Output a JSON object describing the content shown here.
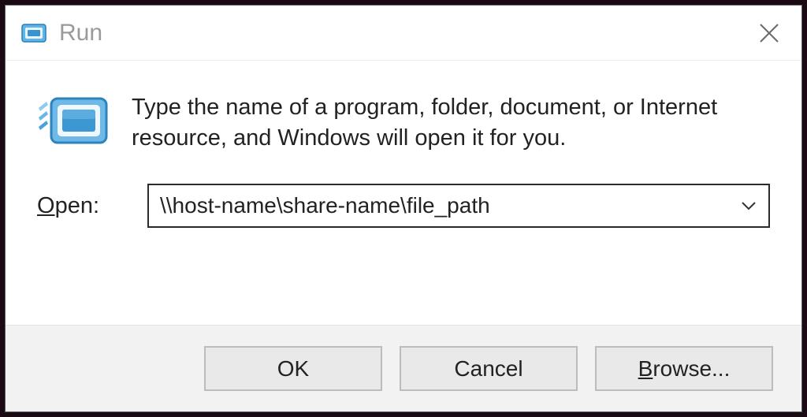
{
  "window": {
    "title": "Run"
  },
  "main": {
    "description": "Type the name of a program, folder, document, or Internet resource, and Windows will open it for you.",
    "open_label_underline": "O",
    "open_label_rest": "pen:",
    "open_value": "\\\\host-name\\share-name\\file_path"
  },
  "buttons": {
    "ok": "OK",
    "cancel": "Cancel",
    "browse_underline": "B",
    "browse_rest": "rowse..."
  }
}
